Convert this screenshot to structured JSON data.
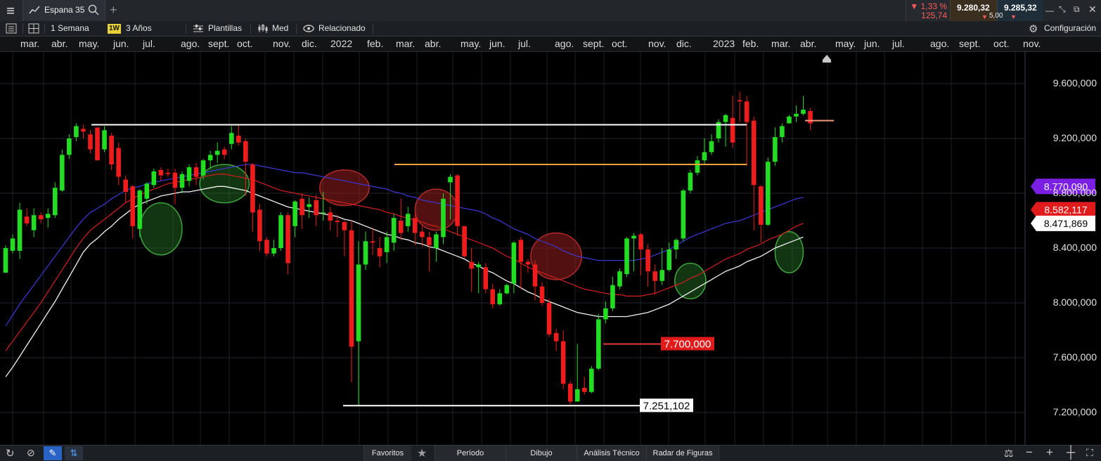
{
  "tab": {
    "label": "Espana 35"
  },
  "quote": {
    "change_pct": "▼ 1,33 %",
    "change_abs": "125,74",
    "bid": "9.280,32",
    "ask": "9.285,32",
    "spread": "5,00"
  },
  "toolbar": {
    "interval": "1 Semana",
    "interval_badge": "1W",
    "range": "3 Años",
    "templates": "Plantillas",
    "price_type": "Med",
    "related": "Relacionado",
    "config": "Configuración"
  },
  "months": [
    "mar.",
    "abr.",
    "may.",
    "jun.",
    "jul.",
    "ago.",
    "sept.",
    "oct.",
    "nov.",
    "dic.",
    "2022",
    "feb.",
    "mar.",
    "abr.",
    "may.",
    "jun.",
    "jul.",
    "ago.",
    "sept.",
    "oct.",
    "nov.",
    "dic.",
    "2023",
    "feb.",
    "mar.",
    "abr.",
    "may.",
    "jun.",
    "jul.",
    "ago.",
    "sept.",
    "oct.",
    "nov."
  ],
  "bottom": {
    "favorites": "Favoritos",
    "period": "Período",
    "drawing": "Dibujo",
    "technical": "Análisis Técnico",
    "patterns": "Radar de Figuras"
  },
  "chart_data": {
    "type": "candlestick",
    "interval": "weekly",
    "ylim": [
      7000000,
      9800000
    ],
    "y_ticks": [
      "9.600,000",
      "9.200,000",
      "8.800,000",
      "8.400,000",
      "8.000,000",
      "7.600,000",
      "7.200,000"
    ],
    "y_tick_values": [
      9600000,
      9200000,
      8800000,
      8400000,
      8000000,
      7600000,
      7200000
    ],
    "up_color": "#22dd22",
    "down_color": "#ee1c1c",
    "candles": [
      [
        8220000,
        8400000,
        8230000,
        8420000
      ],
      [
        8380000,
        8470000,
        8360000,
        8500000
      ],
      [
        8380000,
        8680000,
        8320000,
        8730000
      ],
      [
        8630000,
        8580000,
        8560000,
        8690000
      ],
      [
        8530000,
        8640000,
        8480000,
        8690000
      ],
      [
        8640000,
        8610000,
        8580000,
        8660000
      ],
      [
        8620000,
        8650000,
        8550000,
        8690000
      ],
      [
        8640000,
        8840000,
        8620000,
        8880000
      ],
      [
        8820000,
        9080000,
        8810000,
        9120000
      ],
      [
        9080000,
        9200000,
        9050000,
        9230000
      ],
      [
        9210000,
        9290000,
        9180000,
        9310000
      ],
      [
        9270000,
        9250000,
        9200000,
        9300000
      ],
      [
        9230000,
        9120000,
        9090000,
        9260000
      ],
      [
        9280000,
        9040000,
        9060000,
        9280000
      ],
      [
        9120000,
        9260000,
        9100000,
        9290000
      ],
      [
        9220000,
        9010000,
        8970000,
        9240000
      ],
      [
        9130000,
        8920000,
        8860000,
        9170000
      ],
      [
        8900000,
        8810000,
        8730000,
        8930000
      ],
      [
        8850000,
        8560000,
        8470000,
        8860000
      ],
      [
        8540000,
        8820000,
        8480000,
        8830000
      ],
      [
        8760000,
        8870000,
        8720000,
        8880000
      ],
      [
        8860000,
        8960000,
        8840000,
        8980000
      ],
      [
        8970000,
        8930000,
        8890000,
        8990000
      ],
      [
        8950000,
        8940000,
        8920000,
        8980000
      ],
      [
        8950000,
        8840000,
        8720000,
        8980000
      ],
      [
        8840000,
        8940000,
        8800000,
        8960000
      ],
      [
        8890000,
        8990000,
        8850000,
        9010000
      ],
      [
        8990000,
        8920000,
        8860000,
        9020000
      ],
      [
        8930000,
        9040000,
        8900000,
        9050000
      ],
      [
        9040000,
        9080000,
        8980000,
        9110000
      ],
      [
        9080000,
        9110000,
        9020000,
        9170000
      ],
      [
        9120000,
        9080000,
        9050000,
        9140000
      ],
      [
        9160000,
        9240000,
        9120000,
        9290000
      ],
      [
        9220000,
        9170000,
        9150000,
        9300000
      ],
      [
        9180000,
        9030000,
        8780000,
        9200000
      ],
      [
        9010000,
        8660000,
        8520000,
        9020000
      ],
      [
        8680000,
        8450000,
        8380000,
        8720000
      ],
      [
        8460000,
        8360000,
        8340000,
        8480000
      ],
      [
        8360000,
        8400000,
        8340000,
        8460000
      ],
      [
        8400000,
        8640000,
        8380000,
        8660000
      ],
      [
        8640000,
        8290000,
        8210000,
        8660000
      ],
      [
        8560000,
        8740000,
        8480000,
        8750000
      ],
      [
        8760000,
        8640000,
        8540000,
        8800000
      ],
      [
        8700000,
        8720000,
        8620000,
        8770000
      ],
      [
        8750000,
        8640000,
        8560000,
        8790000
      ],
      [
        8660000,
        8660000,
        8600000,
        8810000
      ],
      [
        8660000,
        8600000,
        8530000,
        8700000
      ],
      [
        8600000,
        8590000,
        8480000,
        8640000
      ],
      [
        8590000,
        8530000,
        8340000,
        8600000
      ],
      [
        8530000,
        7680000,
        7420000,
        8600000
      ],
      [
        7720000,
        8280000,
        7250000,
        8450000
      ],
      [
        8280000,
        8450000,
        8240000,
        8520000
      ],
      [
        8450000,
        8440000,
        8350000,
        8540000
      ],
      [
        8400000,
        8340000,
        8260000,
        8480000
      ],
      [
        8370000,
        8480000,
        8290000,
        8520000
      ],
      [
        8440000,
        8620000,
        8380000,
        8650000
      ],
      [
        8600000,
        8510000,
        8460000,
        8760000
      ],
      [
        8560000,
        8650000,
        8520000,
        8700000
      ],
      [
        8620000,
        8510000,
        8420000,
        8660000
      ],
      [
        8520000,
        8480000,
        8410000,
        8560000
      ],
      [
        8480000,
        8420000,
        8230000,
        8520000
      ],
      [
        8400000,
        8500000,
        8300000,
        8520000
      ],
      [
        8480000,
        8760000,
        8430000,
        8800000
      ],
      [
        8880000,
        8920000,
        8610000,
        8940000
      ],
      [
        8930000,
        8560000,
        8490000,
        8940000
      ],
      [
        8560000,
        8340000,
        8330000,
        8560000
      ],
      [
        8300000,
        8250000,
        8080000,
        8400000
      ],
      [
        8260000,
        8280000,
        8070000,
        8300000
      ],
      [
        8260000,
        8100000,
        8070000,
        8290000
      ],
      [
        8100000,
        7990000,
        7960000,
        8140000
      ],
      [
        7990000,
        8070000,
        7980000,
        8100000
      ],
      [
        8070000,
        8130000,
        8060000,
        8140000
      ],
      [
        8140000,
        8440000,
        8070000,
        8450000
      ],
      [
        8460000,
        8300000,
        8100000,
        8480000
      ],
      [
        8300000,
        8280000,
        8220000,
        8320000
      ],
      [
        8280000,
        8120000,
        8020000,
        8310000
      ],
      [
        8120000,
        8000000,
        7980000,
        8150000
      ],
      [
        8000000,
        7770000,
        7750000,
        8030000
      ],
      [
        7780000,
        7720000,
        7650000,
        7810000
      ],
      [
        7720000,
        7410000,
        7370000,
        7800000
      ],
      [
        7410000,
        7280000,
        7260000,
        7430000
      ],
      [
        7280000,
        7370000,
        7280000,
        7700000
      ],
      [
        7380000,
        7350000,
        7330000,
        7460000
      ],
      [
        7350000,
        7520000,
        7340000,
        7540000
      ],
      [
        7520000,
        7880000,
        7510000,
        7920000
      ],
      [
        7880000,
        7960000,
        7850000,
        8010000
      ],
      [
        7960000,
        8130000,
        7940000,
        8190000
      ],
      [
        8120000,
        8230000,
        8100000,
        8250000
      ],
      [
        8210000,
        8470000,
        8190000,
        8480000
      ],
      [
        8470000,
        8490000,
        8230000,
        8510000
      ],
      [
        8500000,
        8390000,
        8200000,
        8510000
      ],
      [
        8390000,
        8230000,
        8120000,
        8430000
      ],
      [
        8230000,
        8160000,
        8060000,
        8280000
      ],
      [
        8160000,
        8240000,
        8130000,
        8400000
      ],
      [
        8240000,
        8390000,
        8230000,
        8440000
      ],
      [
        8390000,
        8460000,
        8320000,
        8470000
      ],
      [
        8470000,
        8820000,
        8450000,
        8830000
      ],
      [
        8820000,
        8950000,
        8800000,
        8970000
      ],
      [
        8950000,
        9040000,
        8930000,
        9070000
      ],
      [
        9040000,
        9100000,
        9010000,
        9200000
      ],
      [
        9100000,
        9180000,
        9080000,
        9230000
      ],
      [
        9200000,
        9320000,
        9170000,
        9340000
      ],
      [
        9320000,
        9370000,
        9140000,
        9380000
      ],
      [
        9350000,
        9170000,
        9130000,
        9510000
      ],
      [
        9480000,
        9470000,
        9320000,
        9540000
      ],
      [
        9470000,
        9320000,
        9000000,
        9510000
      ],
      [
        9330000,
        8860000,
        8530000,
        9360000
      ],
      [
        8850000,
        8570000,
        8440000,
        8860000
      ],
      [
        8570000,
        9030000,
        8560000,
        9060000
      ],
      [
        9030000,
        9210000,
        9000000,
        9280000
      ],
      [
        9210000,
        9290000,
        9170000,
        9310000
      ],
      [
        9310000,
        9360000,
        9310000,
        9370000
      ],
      [
        9360000,
        9380000,
        9320000,
        9440000
      ],
      [
        9380000,
        9410000,
        9370000,
        9510000
      ],
      [
        9400000,
        9310000,
        9260000,
        9420000
      ]
    ],
    "ma_blue": [
      7830000,
      7910000,
      7990000,
      8060000,
      8130000,
      8200000,
      8270000,
      8340000,
      8410000,
      8480000,
      8550000,
      8610000,
      8660000,
      8690000,
      8720000,
      8760000,
      8790000,
      8820000,
      8840000,
      8850000,
      8870000,
      8880000,
      8890000,
      8900000,
      8910000,
      8920000,
      8930000,
      8940000,
      8950000,
      8960000,
      8970000,
      8980000,
      8990000,
      9000000,
      9010000,
      9010000,
      9000000,
      8990000,
      8980000,
      8970000,
      8960000,
      8950000,
      8950000,
      8940000,
      8930000,
      8920000,
      8910000,
      8900000,
      8890000,
      8880000,
      8870000,
      8860000,
      8850000,
      8840000,
      8830000,
      8810000,
      8800000,
      8780000,
      8770000,
      8750000,
      8740000,
      8730000,
      8720000,
      8710000,
      8700000,
      8690000,
      8680000,
      8670000,
      8650000,
      8620000,
      8600000,
      8570000,
      8540000,
      8520000,
      8500000,
      8470000,
      8450000,
      8430000,
      8410000,
      8380000,
      8360000,
      8340000,
      8330000,
      8320000,
      8310000,
      8310000,
      8310000,
      8310000,
      8310000,
      8310000,
      8320000,
      8330000,
      8350000,
      8370000,
      8390000,
      8420000,
      8450000,
      8480000,
      8500000,
      8520000,
      8540000,
      8560000,
      8580000,
      8590000,
      8600000,
      8620000,
      8640000,
      8660000,
      8680000,
      8700000,
      8720000,
      8740000,
      8760000,
      8770000
    ],
    "ma_red": [
      7650000,
      7720000,
      7790000,
      7860000,
      7930000,
      8000000,
      8080000,
      8160000,
      8240000,
      8320000,
      8400000,
      8470000,
      8530000,
      8570000,
      8610000,
      8650000,
      8690000,
      8730000,
      8760000,
      8790000,
      8810000,
      8830000,
      8850000,
      8870000,
      8880000,
      8890000,
      8900000,
      8910000,
      8920000,
      8930000,
      8940000,
      8940000,
      8930000,
      8920000,
      8910000,
      8900000,
      8880000,
      8860000,
      8840000,
      8820000,
      8810000,
      8800000,
      8790000,
      8780000,
      8770000,
      8760000,
      8750000,
      8740000,
      8730000,
      8720000,
      8710000,
      8700000,
      8690000,
      8680000,
      8660000,
      8650000,
      8630000,
      8620000,
      8600000,
      8590000,
      8570000,
      8560000,
      8540000,
      8520000,
      8500000,
      8480000,
      8460000,
      8440000,
      8420000,
      8400000,
      8370000,
      8340000,
      8320000,
      8290000,
      8260000,
      8240000,
      8220000,
      8200000,
      8180000,
      8160000,
      8140000,
      8120000,
      8100000,
      8090000,
      8080000,
      8070000,
      8060000,
      8060000,
      8050000,
      8050000,
      8050000,
      8060000,
      8070000,
      8090000,
      8110000,
      8130000,
      8150000,
      8180000,
      8200000,
      8230000,
      8260000,
      8290000,
      8320000,
      8340000,
      8360000,
      8390000,
      8410000,
      8430000,
      8460000,
      8480000,
      8500000,
      8530000,
      8560000,
      8580000
    ],
    "ma_white": [
      7460000,
      7530000,
      7610000,
      7690000,
      7770000,
      7850000,
      7930000,
      8010000,
      8100000,
      8190000,
      8280000,
      8370000,
      8430000,
      8470000,
      8520000,
      8560000,
      8610000,
      8650000,
      8690000,
      8720000,
      8740000,
      8760000,
      8780000,
      8790000,
      8800000,
      8810000,
      8810000,
      8820000,
      8830000,
      8840000,
      8850000,
      8850000,
      8840000,
      8830000,
      8820000,
      8800000,
      8780000,
      8760000,
      8740000,
      8720000,
      8700000,
      8690000,
      8680000,
      8670000,
      8660000,
      8650000,
      8640000,
      8630000,
      8610000,
      8600000,
      8580000,
      8560000,
      8540000,
      8520000,
      8500000,
      8490000,
      8470000,
      8460000,
      8440000,
      8430000,
      8410000,
      8400000,
      8380000,
      8360000,
      8340000,
      8320000,
      8290000,
      8270000,
      8240000,
      8220000,
      8190000,
      8160000,
      8140000,
      8110000,
      8080000,
      8060000,
      8030000,
      8010000,
      7990000,
      7970000,
      7950000,
      7930000,
      7920000,
      7910000,
      7900000,
      7900000,
      7900000,
      7900000,
      7900000,
      7910000,
      7920000,
      7930000,
      7950000,
      7970000,
      7990000,
      8020000,
      8050000,
      8080000,
      8110000,
      8140000,
      8170000,
      8200000,
      8230000,
      8250000,
      8270000,
      8300000,
      8320000,
      8340000,
      8370000,
      8400000,
      8420000,
      8440000,
      8460000,
      8480000
    ],
    "hlines": [
      {
        "value": 9300000,
        "color": "#ffffff"
      },
      {
        "value": 9010000,
        "color": "#f2a23c"
      },
      {
        "value": 7250000,
        "color": "#ffffff",
        "label": "7.251,102"
      },
      {
        "value": 7700000,
        "color": "#e23a3a",
        "label": "7.700,000"
      },
      {
        "value": 9330000,
        "color": "#f29a7a"
      }
    ],
    "price_tags": [
      {
        "text": "8.770,090",
        "bg": "#7b1fe4",
        "fg": "#ffffff"
      },
      {
        "text": "8.582,117",
        "bg": "#e01b1b",
        "fg": "#ffffff"
      },
      {
        "text": "8.471,869",
        "bg": "#ffffff",
        "fg": "#000000"
      }
    ]
  }
}
